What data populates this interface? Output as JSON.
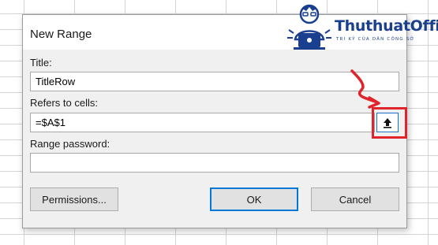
{
  "dialog": {
    "title": "New Range",
    "title_label": "Title:",
    "title_value": "TitleRow",
    "refers_label": "Refers to cells:",
    "refers_value": "=$A$1",
    "password_label": "Range password:",
    "password_value": "",
    "permissions_button": "Permissions...",
    "ok_button": "OK",
    "cancel_button": "Cancel"
  },
  "logo": {
    "name": "ThuthuatOffice",
    "tagline": "TRI KỶ CỦA DÂN CÔNG SỞ"
  },
  "icons": {
    "collapse": "collapse-dialog-icon",
    "annotation_arrow": "red-arrow-icon"
  },
  "colors": {
    "annotation": "#e0242c",
    "focus": "#0078d7",
    "logo": "#1b3f8f"
  }
}
